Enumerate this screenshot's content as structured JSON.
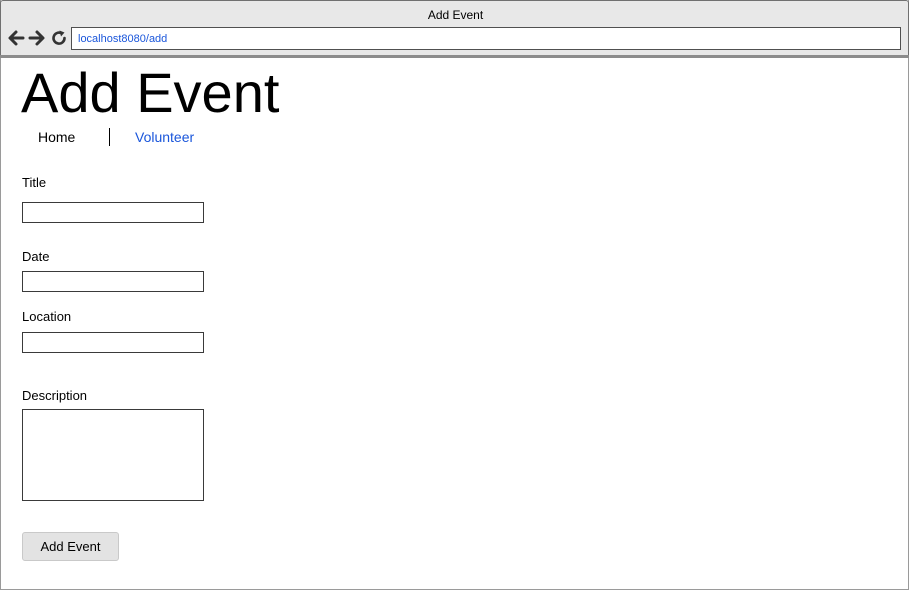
{
  "window": {
    "title": "Add Event"
  },
  "browser": {
    "url": "localhost8080/add",
    "icons": {
      "back": "arrow-left-icon",
      "forward": "arrow-right-icon",
      "reload": "reload-icon"
    }
  },
  "page": {
    "heading": "Add Event",
    "nav": {
      "home": "Home",
      "volunteer": "Volunteer"
    },
    "form": {
      "title_label": "Title",
      "title_value": "",
      "date_label": "Date",
      "date_value": "",
      "location_label": "Location",
      "location_value": "",
      "description_label": "Description",
      "description_value": "",
      "submit_label": "Add Event"
    }
  },
  "colors": {
    "link": "#1a56db",
    "chrome": "#e8e8e8",
    "button": "#e3e3e3"
  }
}
